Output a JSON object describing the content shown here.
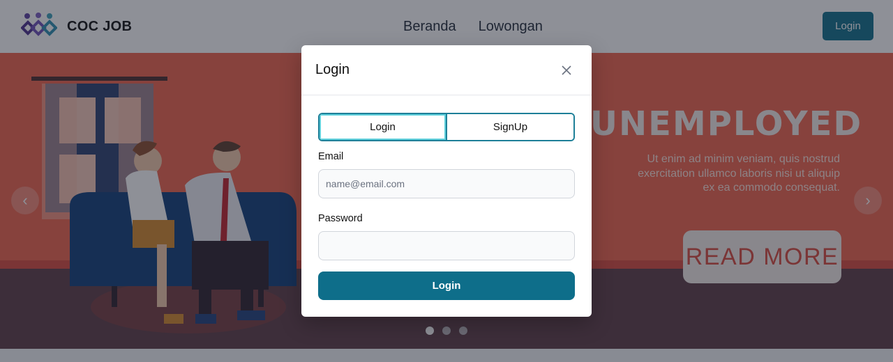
{
  "navbar": {
    "brand": "COC JOB",
    "links": [
      "Beranda",
      "Lowongan"
    ],
    "login_label": "Login"
  },
  "hero": {
    "title": "UNEMPLOYED",
    "text": "Ut enim ad minim veniam, quis nostrud exercitation ullamco laboris nisi ut aliquip ex ea commodo consequat.",
    "read_more": "READ MORE",
    "prev_icon": "chevron-left-icon",
    "next_icon": "chevron-right-icon",
    "slides_count": 3,
    "active_slide": 1
  },
  "modal": {
    "title": "Login",
    "close_icon": "close-icon",
    "tabs": [
      {
        "label": "Login",
        "active": true
      },
      {
        "label": "SignUp",
        "active": false
      }
    ],
    "email": {
      "label": "Email",
      "placeholder": "name@email.com",
      "value": ""
    },
    "password": {
      "label": "Password",
      "placeholder": "",
      "value": ""
    },
    "submit_label": "Login"
  },
  "colors": {
    "primary": "#0e6e8a",
    "hero_bg": "#f0624a",
    "overlay": "rgba(30,34,48,0.5)"
  }
}
